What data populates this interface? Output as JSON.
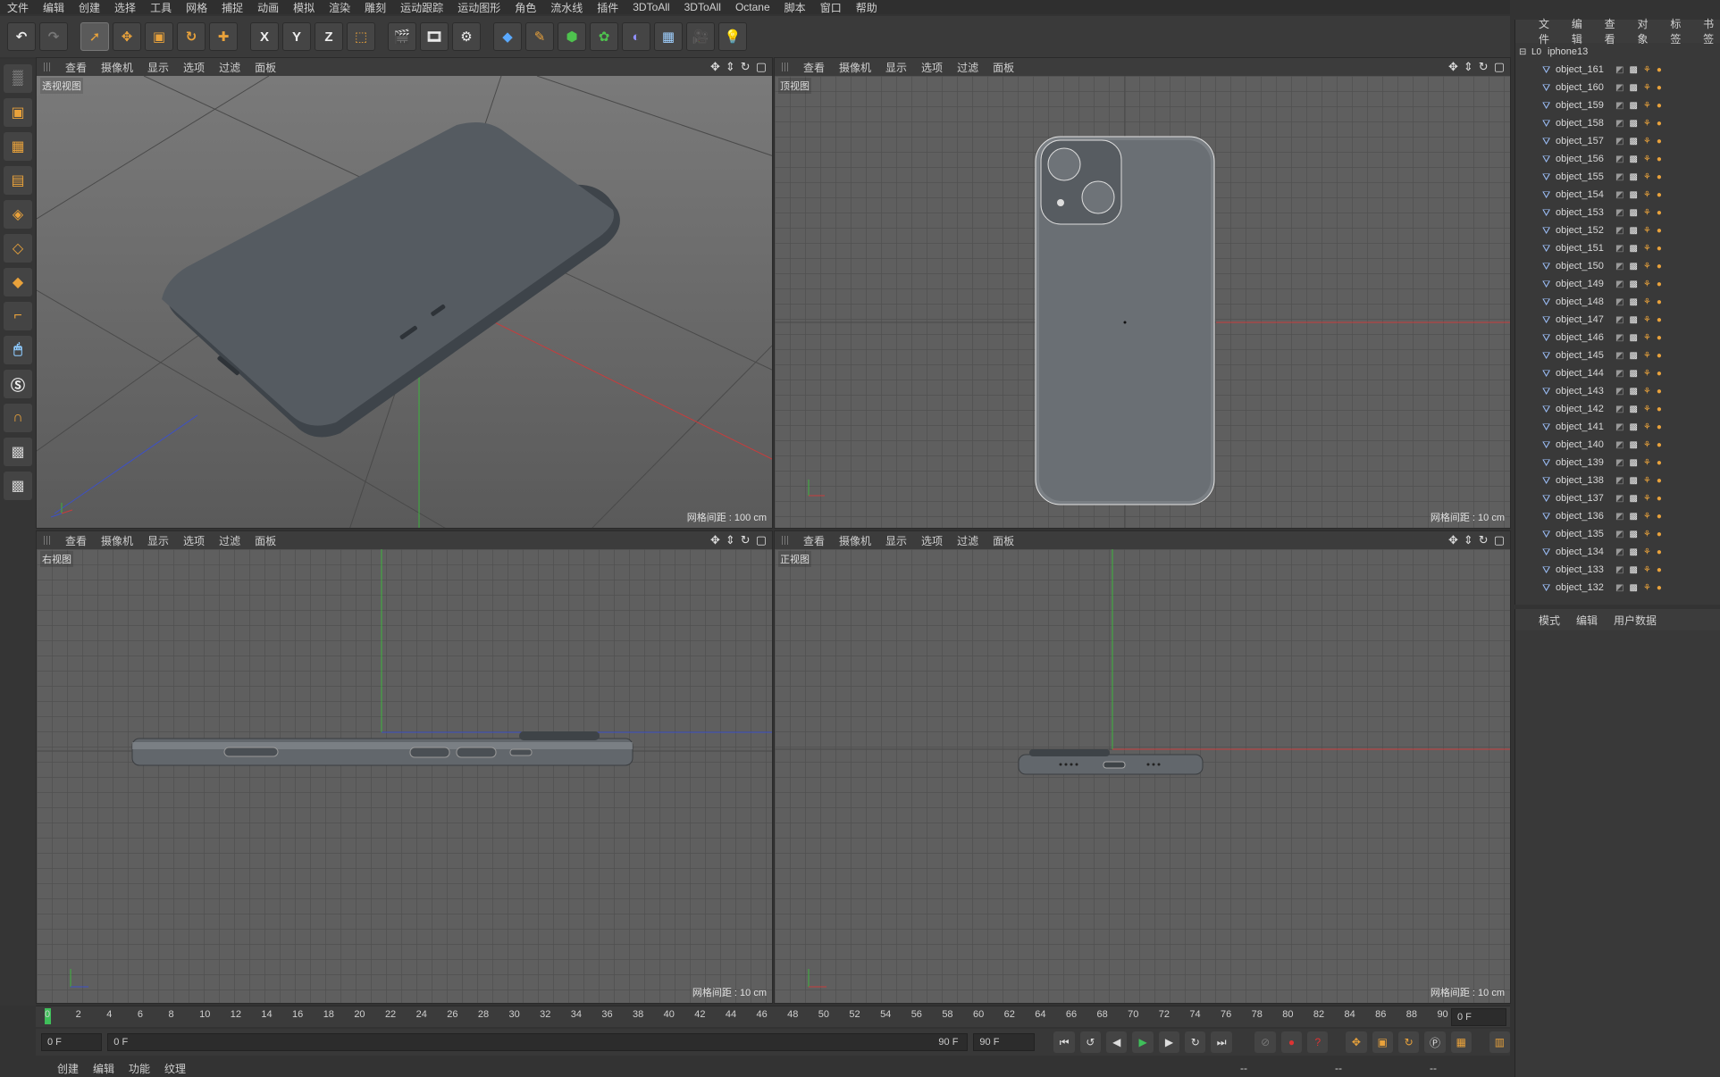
{
  "menu": [
    "文件",
    "编辑",
    "创建",
    "选择",
    "工具",
    "网格",
    "捕捉",
    "动画",
    "模拟",
    "渲染",
    "雕刻",
    "运动跟踪",
    "运动图形",
    "角色",
    "流水线",
    "插件",
    "3DToAll",
    "3DToAll",
    "Octane",
    "脚本",
    "窗口",
    "帮助"
  ],
  "toolbar": {
    "axis_x": "X",
    "axis_y": "Y",
    "axis_z": "Z",
    "icons": [
      "undo-icon",
      "redo-icon",
      "select-icon",
      "move-icon",
      "scale-icon",
      "rotate-icon",
      "plus-icon",
      "axis-x",
      "axis-y",
      "axis-z",
      "coord-icon",
      "render-view-icon",
      "render-icon",
      "render-settings-icon",
      "cube-icon",
      "pen-icon",
      "nurbs-icon",
      "mograph-icon",
      "deformer-icon",
      "scene-icon",
      "camera-icon",
      "light-icon"
    ]
  },
  "viewports": [
    {
      "menu": [
        "查看",
        "摄像机",
        "显示",
        "选项",
        "过滤",
        "面板"
      ],
      "label": "透视视图",
      "grid": "网格间距 : 100 cm"
    },
    {
      "menu": [
        "查看",
        "摄像机",
        "显示",
        "选项",
        "过滤",
        "面板"
      ],
      "label": "顶视图",
      "grid": "网格间距 : 10 cm"
    },
    {
      "menu": [
        "查看",
        "摄像机",
        "显示",
        "选项",
        "过滤",
        "面板"
      ],
      "label": "右视图",
      "grid": "网格间距 : 10 cm"
    },
    {
      "menu": [
        "查看",
        "摄像机",
        "显示",
        "选项",
        "过滤",
        "面板"
      ],
      "label": "正视图",
      "grid": "网格间距 : 10 cm"
    }
  ],
  "timeline": {
    "ticks": [
      "0",
      "2",
      "4",
      "6",
      "8",
      "10",
      "12",
      "14",
      "16",
      "18",
      "20",
      "22",
      "24",
      "26",
      "28",
      "30",
      "32",
      "34",
      "36",
      "38",
      "40",
      "42",
      "44",
      "46",
      "48",
      "50",
      "52",
      "54",
      "56",
      "58",
      "60",
      "62",
      "64",
      "66",
      "68",
      "70",
      "72",
      "74",
      "76",
      "78",
      "80",
      "82",
      "84",
      "86",
      "88",
      "90"
    ],
    "end_field": "0 F",
    "start_frame": "0 F",
    "range_start": "0 F",
    "range_end": "90 F",
    "max_frame": "90 F"
  },
  "bottom_tabs": [
    "创建",
    "编辑",
    "功能",
    "纹理"
  ],
  "status": [
    "--",
    "--",
    "--"
  ],
  "object_manager": {
    "tabs": [
      "文件",
      "编辑",
      "查看",
      "对象",
      "标签",
      "书签"
    ],
    "root": "iphone13",
    "objects": [
      "object_161",
      "object_160",
      "object_159",
      "object_158",
      "object_157",
      "object_156",
      "object_155",
      "object_154",
      "object_153",
      "object_152",
      "object_151",
      "object_150",
      "object_149",
      "object_148",
      "object_147",
      "object_146",
      "object_145",
      "object_144",
      "object_143",
      "object_142",
      "object_141",
      "object_140",
      "object_139",
      "object_138",
      "object_137",
      "object_136",
      "object_135",
      "object_134",
      "object_133",
      "object_132"
    ]
  },
  "attributes": {
    "tabs": [
      "模式",
      "编辑",
      "用户数据"
    ]
  },
  "colors": {
    "accent": "#e9a23b",
    "bg": "#333333",
    "viewport": "#5f5f5f",
    "axis_x": "#c83c3c",
    "axis_y": "#3cb43c",
    "axis_z": "#3c50c8",
    "phone": "#555b61"
  }
}
